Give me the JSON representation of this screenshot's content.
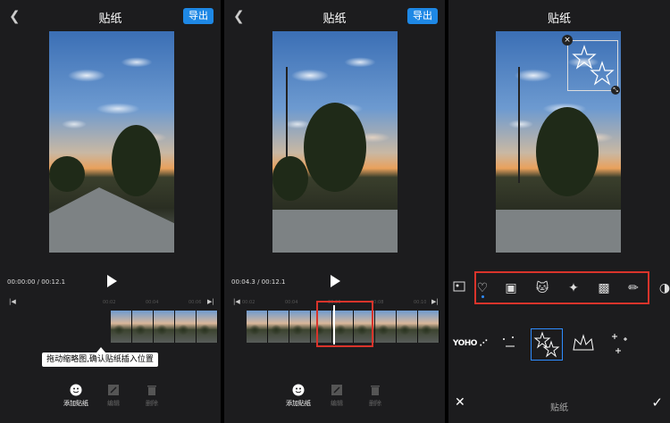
{
  "panel1": {
    "title": "贴纸",
    "export_label": "导出",
    "time_display": "00:00:00 / 00:12.1",
    "tooltip": "拖动缩略图,确认贴纸插入位置",
    "tools": [
      {
        "label": "添加贴纸",
        "icon": "smiley-icon"
      },
      {
        "label": "编辑",
        "icon": "edit-icon"
      },
      {
        "label": "删除",
        "icon": "trash-icon"
      }
    ]
  },
  "panel2": {
    "title": "贴纸",
    "export_label": "导出",
    "time_display": "00:04.3 / 00:12.1",
    "tools": [
      {
        "label": "添加贴纸",
        "icon": "smiley-icon"
      },
      {
        "label": "编辑",
        "icon": "edit-icon"
      },
      {
        "label": "删除",
        "icon": "trash-icon"
      }
    ]
  },
  "ruler_marks": [
    "00:02",
    "00:04",
    "00:06",
    "00:08",
    "00:10"
  ],
  "panel3": {
    "title": "贴纸",
    "categories": [
      "image-cut-icon",
      "heart-icon",
      "bandage-icon",
      "cat-face-icon",
      "sparkle-icon",
      "camera-icon",
      "pen-icon",
      "watermelon-icon"
    ],
    "stickers": [
      "yoho-sticker",
      "dots-sticker",
      "stars-sticker",
      "crown-sticker",
      "sparkles-sticker"
    ],
    "yoho_text": "YOHO",
    "bottom_label": "贴纸"
  },
  "colors": {
    "accent": "#1e88e5",
    "highlight": "#d9342b",
    "selected_dot": "#2f8cff"
  }
}
